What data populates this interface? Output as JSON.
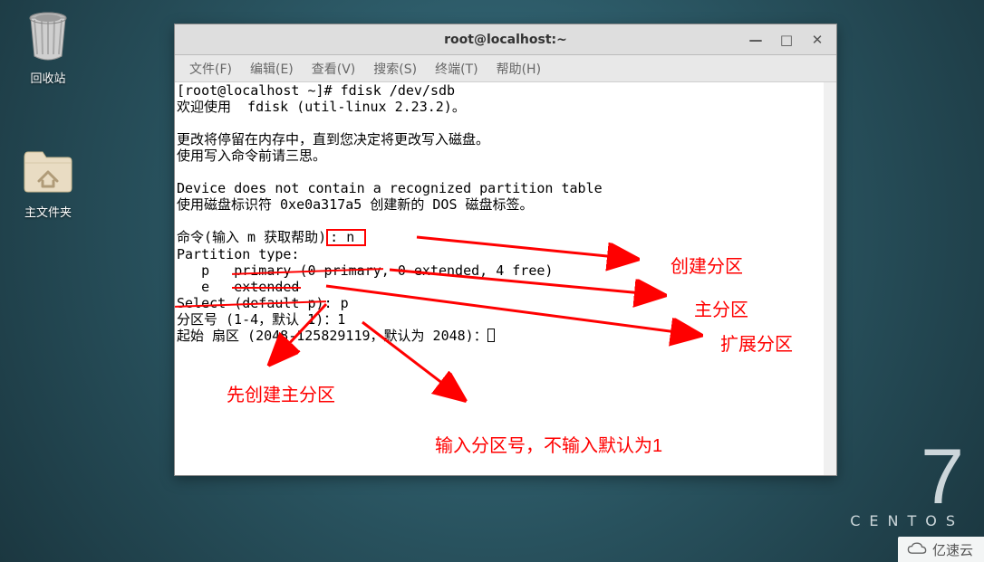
{
  "desktop": {
    "icons": {
      "trash_label": "回收站",
      "home_label": "主文件夹"
    }
  },
  "window": {
    "title": "root@localhost:~",
    "menus": {
      "file": "文件(F)",
      "edit": "编辑(E)",
      "view": "查看(V)",
      "search": "搜索(S)",
      "terminal": "终端(T)",
      "help": "帮助(H)"
    }
  },
  "terminal": {
    "l1": "[root@localhost ~]# fdisk /dev/sdb",
    "l2": "欢迎使用  fdisk (util-linux 2.23.2)。",
    "l3": "",
    "l4": "更改将停留在内存中，直到您决定将更改写入磁盘。",
    "l5": "使用写入命令前请三思。",
    "l6": "",
    "l7": "Device does not contain a recognized partition table",
    "l8": "使用磁盘标识符 0xe0a317a5 创建新的 DOS 磁盘标签。",
    "l9": "",
    "l10a": "命令(输入 m 获取帮助)",
    "l10b": ": n ",
    "l11": "Partition type:",
    "l12a": "   p   ",
    "l12b": "primary (0 primary",
    "l12c": ", 0 extended, 4 free)",
    "l13a": "   e   ",
    "l13b": "extended",
    "l14a": "Select (default p)",
    "l14b": ": p",
    "l15": "分区号 (1-4，默认 1)：1",
    "l16": "起始 扇区 (2048-125829119，默认为 2048)："
  },
  "annotations": {
    "create": "创建分区",
    "primary": "主分区",
    "extended": "扩展分区",
    "make_primary_first": "先创建主分区",
    "enter_number": "输入分区号，不输入默认为1"
  },
  "branding": {
    "seven": "7",
    "name": "CENTOS",
    "watermark": "亿速云"
  }
}
